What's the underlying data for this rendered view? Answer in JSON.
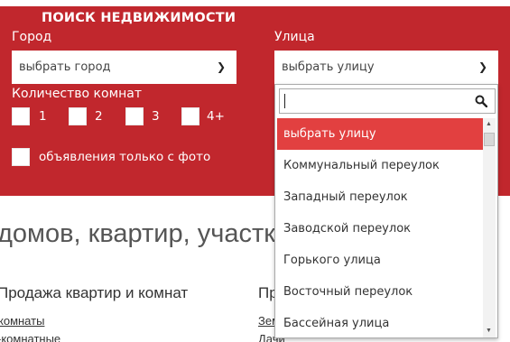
{
  "search": {
    "title": "ПОИСК НЕДВИЖИМОСТИ",
    "city_label": "Город",
    "city_value": "выбрать город",
    "street_label": "Улица",
    "street_value": "выбрать улицу",
    "rooms_label": "Количество комнат",
    "rooms": [
      "1",
      "2",
      "3",
      "4+"
    ],
    "photo_only_label": "объявления только с фото"
  },
  "street_dropdown": {
    "search_value": "",
    "items": [
      "выбрать улицу",
      "Коммунальный переулок",
      "Западный переулок",
      "Заводской переулок",
      "Горького улица",
      "Восточный переулок",
      "Бассейная улица"
    ],
    "selected_index": 0
  },
  "content": {
    "heading": "домов, квартир, участк",
    "col1_title": "Продажа квартир и комнат",
    "col1_links": [
      "комнаты",
      "-комнатные"
    ],
    "col2_title": "Пр",
    "col2_links": [
      "Зем",
      "Дачи"
    ]
  },
  "colors": {
    "panel_bg": "#c1272d",
    "selected_item_bg": "#e24040"
  }
}
